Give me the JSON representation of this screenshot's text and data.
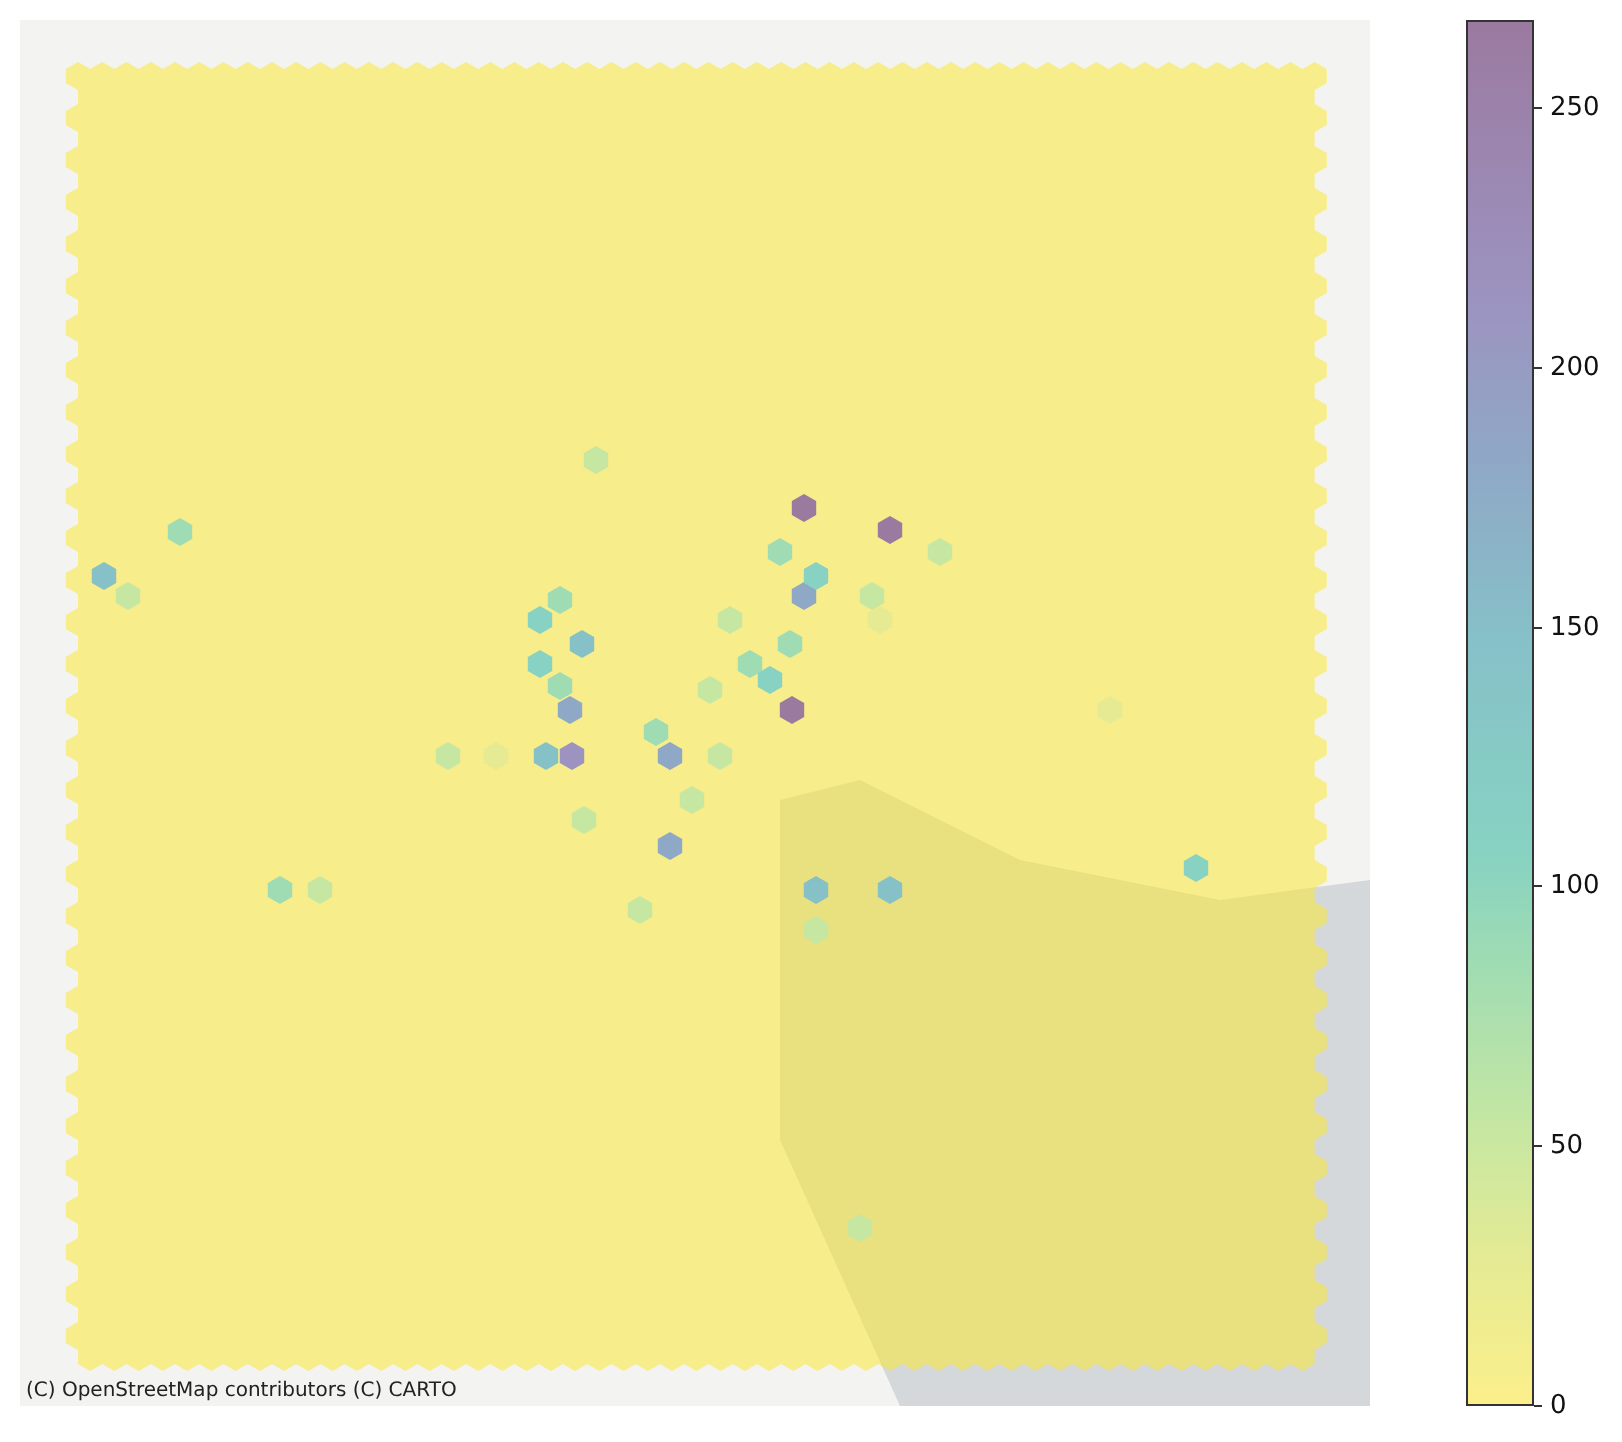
{
  "map": {
    "attribution": "(C) OpenStreetMap contributors (C) CARTO"
  },
  "colorbar": {
    "ticks": [
      "250",
      "200",
      "150",
      "100",
      "50",
      "0"
    ]
  }
}
